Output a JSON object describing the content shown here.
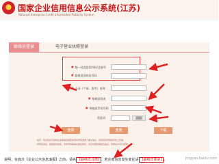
{
  "header": {
    "title": "国家企业信用信息公示系统(江苏)",
    "subtitle": "National Enterprise Credit Information Publicity System"
  },
  "tabs": [
    {
      "label": "联络员登录"
    },
    {
      "label": "电子营业执照登录"
    }
  ],
  "form": {
    "credit_code_label": "统一社会信用代码/注册号",
    "id_number_label": "联络员身份证号码",
    "enterprise_name_label": "企业（个体、农专）名称",
    "liaison_name_label": "联络员姓名",
    "liaison_phone_label": "联络员手机号码",
    "captcha_label": "验证码"
  },
  "buttons": {
    "login": "登录",
    "reset": "重置",
    "download": "下载"
  },
  "notes": {
    "line1": "提示：登记机关已经向企业联络员绑定的手机号码发送了相关信息，请您到该号码的手机上查收。",
    "line2": "登录完成后，如联络员姓名、手机号码等信息发生变化，请及时更新联络员信息，登录后30天内有效。"
  },
  "bottom": {
    "prefix": "说明：在首次【企业公示信息填报】之前，请先",
    "register_link": "【联络员注册】",
    "middle": "。若注册信息发生变化请",
    "change_link": "【联络员变更】",
    "suffix": "。"
  },
  "watermark": "jingyan.baidu.com",
  "colors": {
    "brand_red": "#c81e1e",
    "tab_active": "#e98f8f",
    "button": "#e69a70",
    "annotation_red": "#e02020"
  }
}
